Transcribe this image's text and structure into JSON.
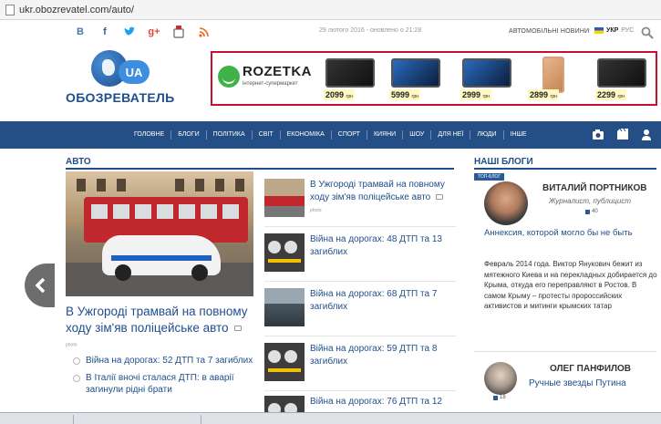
{
  "browser": {
    "url": "ukr.obozrevatel.com/auto/"
  },
  "topbar": {
    "social": [
      "В",
      "f",
      "t",
      "g+",
      "yt",
      "rss"
    ],
    "date": "29 лютого 2016 - оновлено о 21:28",
    "auto_news": "АВТОМОБІЛЬНІ НОВИНИ",
    "lang_ukr": "УКР",
    "lang_rus": "РУС"
  },
  "logo": {
    "text": "ОБОЗРЕВАТЕЛЬ",
    "badge": "UA"
  },
  "banner": {
    "brand": "ROZETKA",
    "tagline": "інтернет-супермаркет",
    "currency": "грн",
    "prices": [
      "2099",
      "5999",
      "2999",
      "2899",
      "2299"
    ]
  },
  "nav": {
    "items": [
      "ГОЛОВНЕ",
      "БЛОГИ",
      "ПОЛІТИКА",
      "СВІТ",
      "ЕКОНОМІКА",
      "СПОРТ",
      "КИЯНИ",
      "ШОУ",
      "ДЛЯ НЕЇ",
      "ЛЮДИ",
      "ІНШЕ"
    ]
  },
  "section": {
    "title": "АВТО"
  },
  "main_story": {
    "title": "В Ужгороді трамвай на повному ходу зім'яв поліцейське авто",
    "photo_source": "photo"
  },
  "sub_stories": [
    "Війна на дорогах: 52 ДТП та 7 загиблих",
    "В Італії вночі сталася ДТП: в аварії загинули рідні брати"
  ],
  "mid_list": [
    {
      "title": "В Ужгороді трамвай на повному ходу зім'яв поліцейське авто",
      "photo_source": "photo"
    },
    {
      "title": "Війна на дорогах: 48 ДТП та 13 загиблих"
    },
    {
      "title": "Війна на дорогах: 68 ДТП та 7 загиблих"
    },
    {
      "title": "Війна на дорогах: 59 ДТП та 8 загиблих"
    },
    {
      "title": "Війна на дорогах: 76 ДТП та 12"
    }
  ],
  "blogs": {
    "title": "НАШІ БЛОГИ",
    "badge": "ТОП-БЛОГ",
    "first": {
      "author": "ВИТАЛИЙ ПОРТНИКОВ",
      "role": "Журналист, публицист",
      "likes": "40",
      "title": "Аннексия, которой могло бы не быть",
      "text": "Февраль 2014 года. Виктор Янукович бежит из мятежного Киева и на перекладных добирается до Крыма, откуда его переправляют в Ростов. В самом Крыму – протесты пророссийских активистов и митинги крымских татар"
    },
    "second": {
      "author": "ОЛЕГ ПАНФИЛОВ",
      "likes": "18",
      "title": "Ручные звезды Путина"
    }
  }
}
